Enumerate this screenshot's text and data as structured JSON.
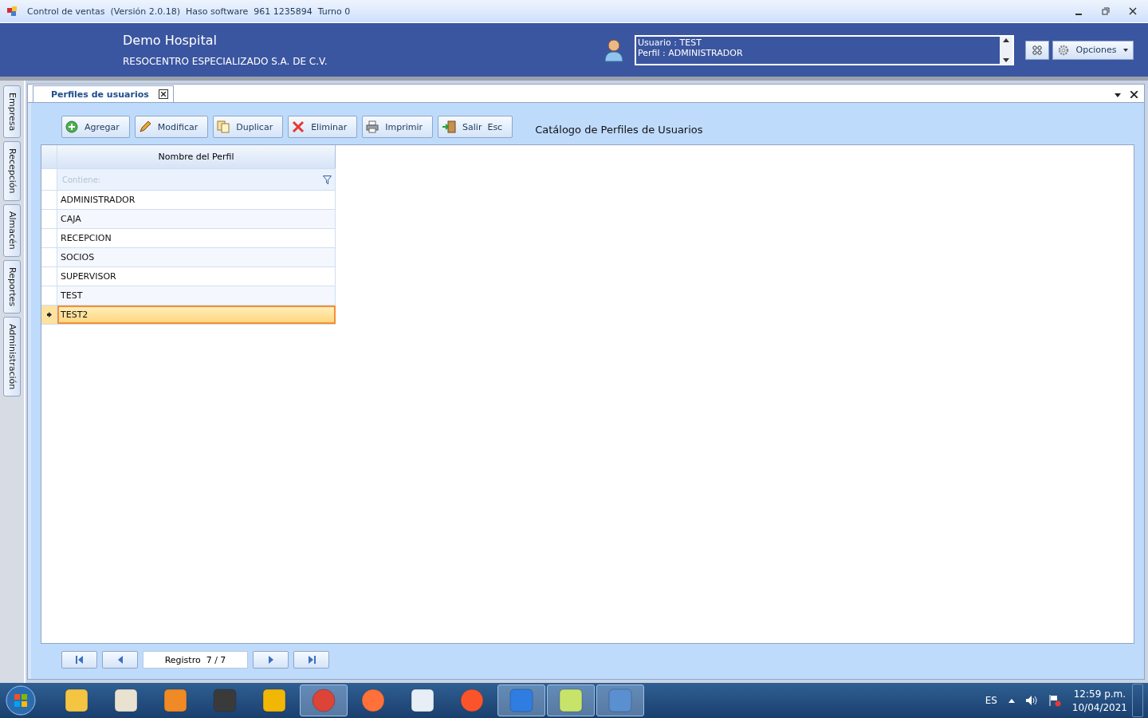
{
  "window": {
    "title": "Control de ventas  (Versión 2.0.18)  Haso software  961 1235894  Turno 0"
  },
  "header": {
    "company": "Demo Hospital",
    "subtitle": "RESOCENTRO ESPECIALIZADO S.A. DE C.V.",
    "user_lines": [
      "Usuario : TEST",
      "Perfil : ADMINISTRADOR"
    ],
    "options_button": "Opciones"
  },
  "side_tabs": [
    {
      "label": "Empresa"
    },
    {
      "label": "Recepción"
    },
    {
      "label": "Almacén"
    },
    {
      "label": "Reportes"
    },
    {
      "label": "Administración"
    }
  ],
  "document_tab": {
    "label": "Perfiles de usuarios"
  },
  "toolbar": [
    {
      "label": "Agregar",
      "kind": "add"
    },
    {
      "label": "Modificar",
      "kind": "edit"
    },
    {
      "label": "Duplicar",
      "kind": "copy"
    },
    {
      "label": "Eliminar",
      "kind": "delete"
    },
    {
      "label": "Imprimir",
      "kind": "print"
    },
    {
      "label": "Salir  Esc",
      "kind": "exit"
    }
  ],
  "catalog_title": "Catálogo de Perfiles de Usuarios",
  "table": {
    "columns": [
      "Nombre del Perfil"
    ],
    "filter_placeholder": "Contiene:",
    "rows": [
      {
        "name": "ADMINISTRADOR",
        "selected": false
      },
      {
        "name": "CAJA",
        "selected": false
      },
      {
        "name": "RECEPCION",
        "selected": false
      },
      {
        "name": "SOCIOS",
        "selected": false
      },
      {
        "name": "SUPERVISOR",
        "selected": false
      },
      {
        "name": "TEST",
        "selected": false
      },
      {
        "name": "TEST2",
        "selected": true
      }
    ]
  },
  "pager": {
    "record": "Registro  7 / 7"
  },
  "taskbar": {
    "apps": [
      {
        "running": false
      },
      {
        "running": false
      },
      {
        "running": false
      },
      {
        "running": false
      },
      {
        "running": false
      },
      {
        "running": true
      },
      {
        "running": false
      },
      {
        "running": false
      },
      {
        "running": false
      },
      {
        "running": true
      },
      {
        "running": true
      },
      {
        "running": true
      }
    ],
    "language": "ES",
    "time": "12:59 p.m.",
    "date": "10/04/2021"
  }
}
